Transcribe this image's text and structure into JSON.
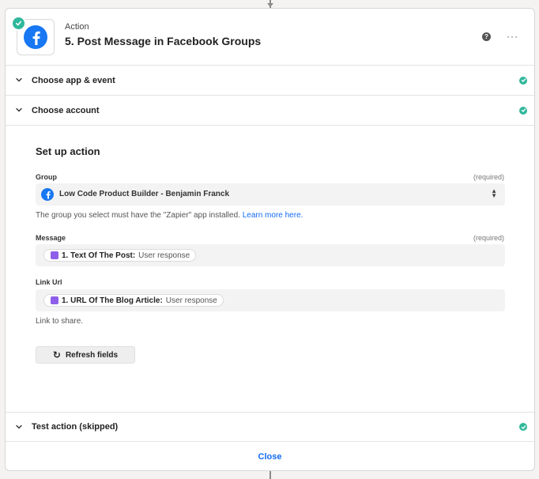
{
  "header": {
    "kicker": "Action",
    "title": "5. Post Message in Facebook Groups",
    "help_glyph": "?",
    "more_glyph": "···",
    "app_icon": "facebook-icon",
    "status_icon": "check-circle-icon"
  },
  "sections": {
    "choose_app": "Choose app & event",
    "choose_account": "Choose account",
    "test_action": "Test action (skipped)"
  },
  "setup": {
    "title": "Set up action",
    "group": {
      "label": "Group",
      "required": "(required)",
      "value": "Low Code Product Builder - Benjamin Franck",
      "help_prefix": "The group you select must have the \"Zapier\" app installed. ",
      "help_link": "Learn more here."
    },
    "message": {
      "label": "Message",
      "required": "(required)",
      "pill_step": "1. Text Of The Post:",
      "pill_value": "User response"
    },
    "link_url": {
      "label": "Link Url",
      "pill_step": "1. URL Of The Blog Article:",
      "pill_value": "User response",
      "help": "Link to share."
    },
    "refresh_label": "Refresh fields"
  },
  "footer": {
    "close_label": "Close"
  },
  "colors": {
    "accent": "#136bf5",
    "success": "#2fb89b",
    "facebook": "#1877f2",
    "pill_icon": "#8e5ee8"
  }
}
